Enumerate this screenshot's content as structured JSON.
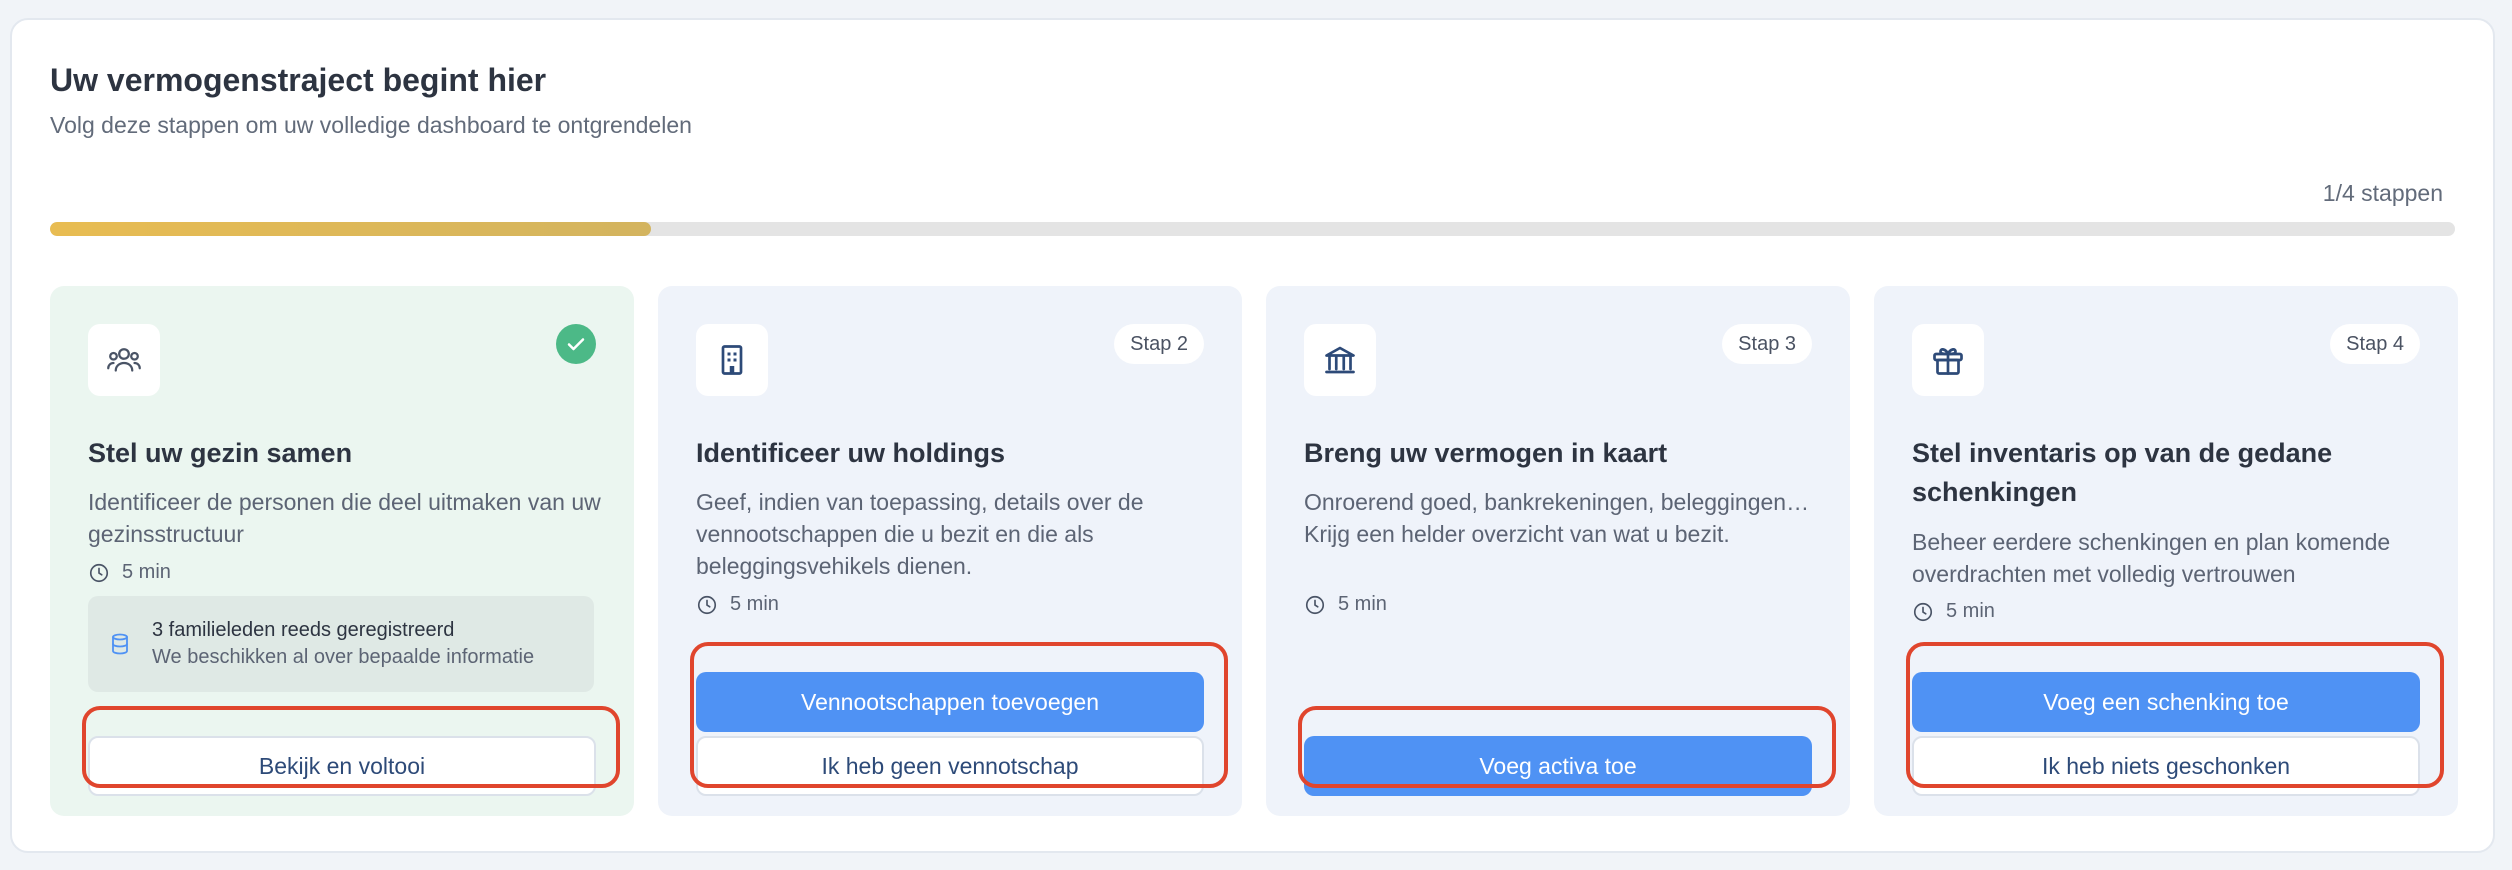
{
  "header": {
    "title": "Uw vermogenstraject begint hier",
    "subtitle": "Volg deze stappen om uw volledige dashboard te ontgrendelen",
    "steps_label": "1/4 stappen",
    "progress_fraction": 0.25
  },
  "colors": {
    "accent": "#4f92f4",
    "progress": "#e3b955",
    "done": "#4cb987",
    "highlight": "#e0452d"
  },
  "cards": [
    {
      "icon": "users-icon",
      "status": "completed",
      "title": "Stel uw gezin samen",
      "description": "Identificeer de personen die deel uitmaken van uw gezinsstructuur",
      "time": "5 min",
      "info": {
        "line1": "3 familieleden reeds geregistreerd",
        "line2": "We beschikken al over bepaalde informatie"
      },
      "secondary_button": "Bekijk en voltooi"
    },
    {
      "icon": "building-icon",
      "badge": "Stap 2",
      "title": "Identificeer uw holdings",
      "description": "Geef, indien van toepassing, details over de vennootschappen die u bezit en die als beleggingsvehikels dienen.",
      "time": "5 min",
      "primary_button": "Vennootschappen toevoegen",
      "secondary_button": "Ik heb geen vennotschap"
    },
    {
      "icon": "bank-icon",
      "badge": "Stap 3",
      "title": "Breng uw vermogen in kaart",
      "description": "Onroerend goed, bankrekeningen, beleggingen… Krijg een helder overzicht van wat u bezit.",
      "time": "5 min",
      "primary_button": "Voeg activa toe"
    },
    {
      "icon": "gift-icon",
      "badge": "Stap 4",
      "title": "Stel inventaris op van de gedane schenkingen",
      "description": "Beheer eerdere schenkingen en plan komende overdrachten met volledig vertrouwen",
      "time": "5 min",
      "primary_button": "Voeg een schenking toe",
      "secondary_button": "Ik heb niets geschonken"
    }
  ]
}
